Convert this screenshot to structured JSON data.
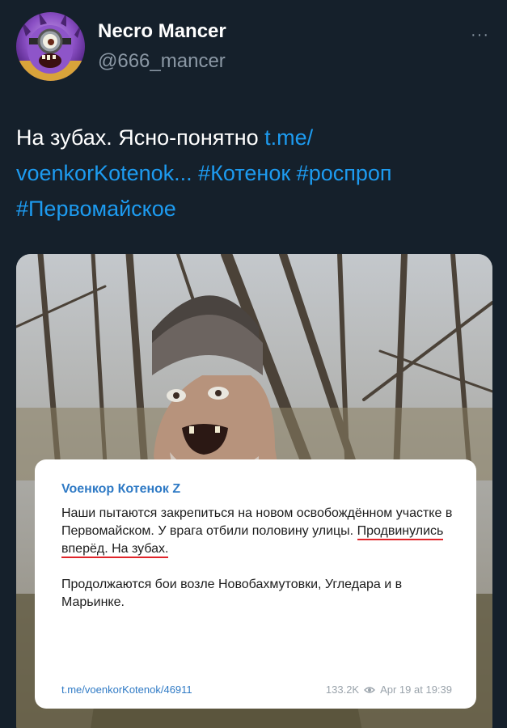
{
  "author": {
    "display_name": "Necro Mancer",
    "handle": "@666_mancer",
    "avatar_icon": "minion-avatar-icon"
  },
  "more_icon": "more-options-icon",
  "tweet": {
    "text_plain": "На зубах. Ясно-понятно ",
    "link_1": "t.me/",
    "link_2": "voenkorKotenok...",
    "hashtag_1": "#Котенок",
    "hashtag_2": "#роспроп",
    "hashtag_3": "#Первомайское"
  },
  "telegram_card": {
    "channel": "Voенкор Котенок Z",
    "para1_a": "Наши пытаются закрепиться на новом освобождённом участке в Первомайском. У врага отбили половину улицы. ",
    "para1_highlight": "Продвинулись вперёд. На зубах.",
    "para2": "Продолжаются бои возле Новобахмутовки, Угледара и в Марьинке.",
    "post_link": "t.me/voenkorKotenok/46911",
    "views": "133.2K",
    "date": "Apr 19 at 19:39"
  },
  "colors": {
    "background": "#15202b",
    "link": "#1d9bf0",
    "highlight_underline": "#e0252a"
  }
}
